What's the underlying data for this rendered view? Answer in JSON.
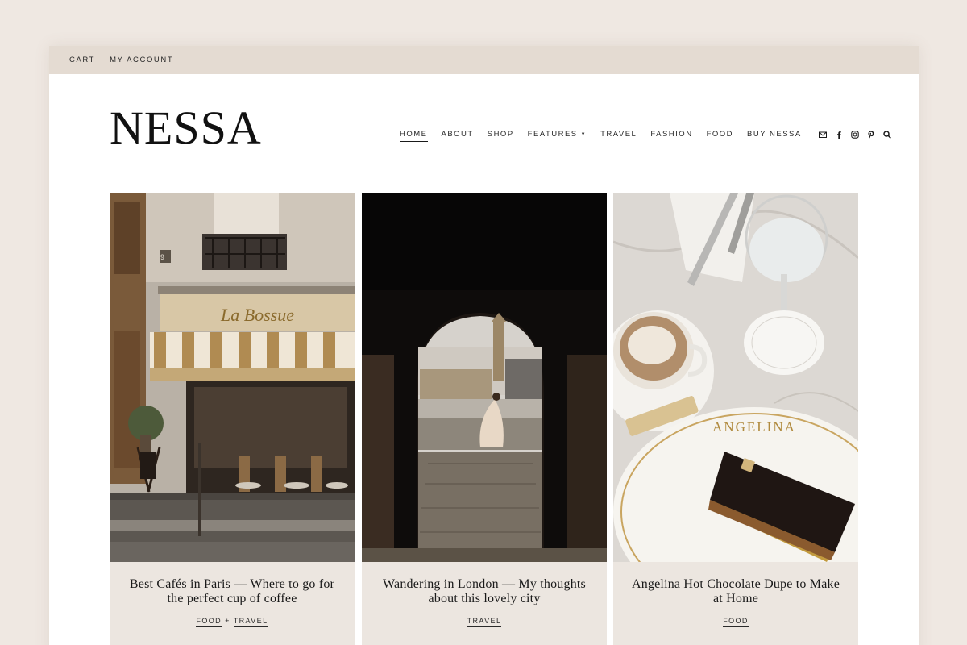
{
  "topbar": {
    "links": [
      "CART",
      "MY ACCOUNT"
    ]
  },
  "brand": {
    "name": "NESSA"
  },
  "nav": {
    "items": [
      {
        "label": "HOME",
        "active": true
      },
      {
        "label": "ABOUT"
      },
      {
        "label": "SHOP"
      },
      {
        "label": "FEATURES",
        "dropdown": true
      },
      {
        "label": "TRAVEL"
      },
      {
        "label": "FASHION"
      },
      {
        "label": "FOOD"
      },
      {
        "label": "BUY NESSA"
      }
    ],
    "social_icons": [
      "email-icon",
      "facebook-icon",
      "instagram-icon",
      "pinterest-icon",
      "search-icon"
    ]
  },
  "posts": [
    {
      "title": "Best Cafés in Paris — Where to go for the perfect cup of coffee",
      "categories": [
        "FOOD",
        "TRAVEL"
      ],
      "category_separator": "+"
    },
    {
      "title": "Wandering in London — My thoughts about this lovely city",
      "categories": [
        "TRAVEL"
      ]
    },
    {
      "title": "Angelina Hot Chocolate Dupe to Make at Home",
      "categories": [
        "FOOD"
      ]
    }
  ],
  "photo_text": {
    "cafe_sign": "La Bossue",
    "shop_number": "9",
    "plate_text": "ANGELINA"
  },
  "colors": {
    "background": "#efe8e2",
    "topbar": "#e4dbd2",
    "caption_bg": "#ece6e0",
    "text": "#1a1a1a"
  }
}
